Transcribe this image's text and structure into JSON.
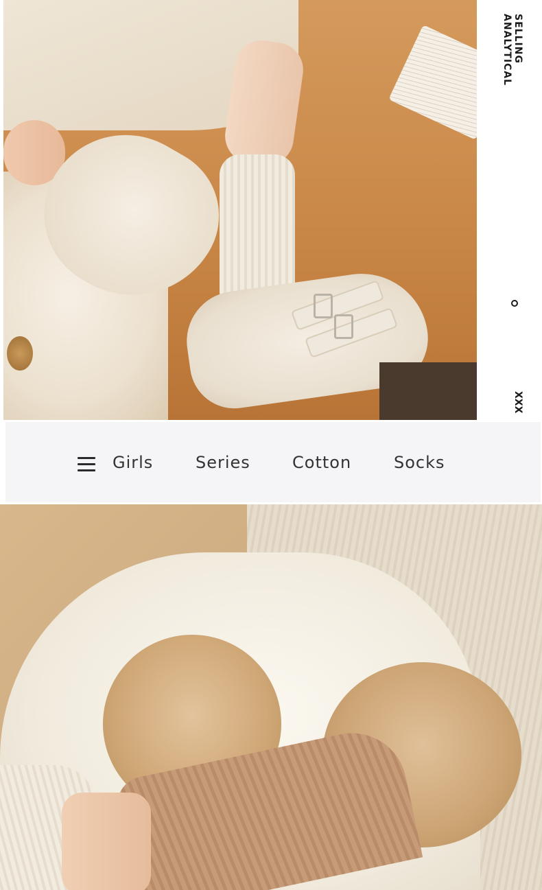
{
  "side": {
    "title": "SELLING ANALYTICAL",
    "marker": "XXX"
  },
  "banner": {
    "words": [
      "Girls",
      "Series",
      "Cotton",
      "Socks"
    ]
  },
  "colors": {
    "banner_bg": "#f5f5f7",
    "banner_text": "#333333",
    "side_text": "#1a1a1a"
  },
  "icons": [
    "menu-icon",
    "circle-icon"
  ]
}
